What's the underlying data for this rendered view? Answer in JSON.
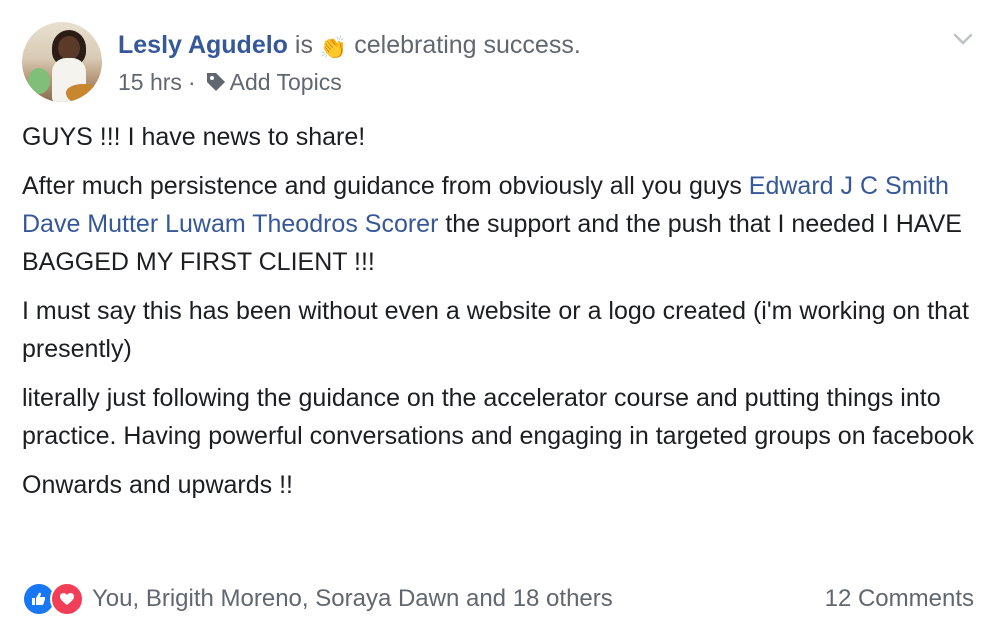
{
  "post": {
    "author": "Lesly Agudelo",
    "verb": "is",
    "activity_emoji": "👏",
    "activity": "celebrating success.",
    "time": "15 hrs",
    "separator": "·",
    "add_topics": "Add Topics",
    "paragraphs": {
      "p1": "GUYS !!! I have news to share!",
      "p2_a": "After much persistence and guidance from obviously all you guys ",
      "mention1": "Edward J C Smith",
      "mention2": "Dave Mutter",
      "mention3": "Luwam Theodros Scorer",
      "p2_b": " the support and the push that I needed I HAVE BAGGED MY FIRST CLIENT !!!",
      "p3": "I must say this has been without even a website or a logo created (i'm working on that presently)",
      "p4": "literally just following the guidance on the accelerator course and putting things into practice. Having powerful conversations and engaging in targeted groups on facebook",
      "p5": "Onwards and upwards !!"
    },
    "reactions_text": "You, Brigith Moreno, Soraya Dawn and 18 others",
    "comments_text": "12 Comments"
  },
  "icons": {
    "tag": "tag-icon",
    "chevron": "chevron-down-icon",
    "like": "like-reaction-icon",
    "love": "love-reaction-icon"
  },
  "colors": {
    "link": "#365899",
    "secondary": "#606770",
    "text": "#1c1e21",
    "like": "#1877f2",
    "love": "#f33e58"
  }
}
